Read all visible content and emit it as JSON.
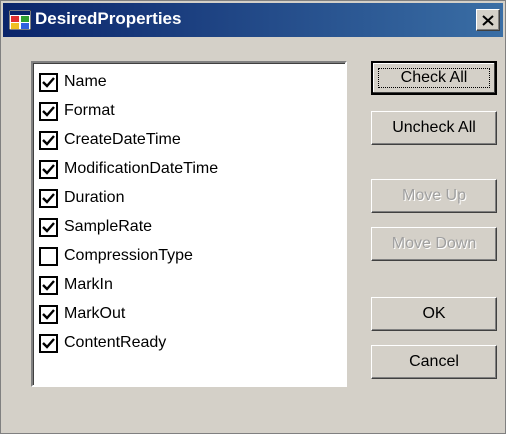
{
  "window": {
    "title": "DesiredProperties",
    "close_label": "×"
  },
  "properties": [
    {
      "label": "Name",
      "checked": true
    },
    {
      "label": "Format",
      "checked": true
    },
    {
      "label": "CreateDateTime",
      "checked": true
    },
    {
      "label": "ModificationDateTime",
      "checked": true
    },
    {
      "label": "Duration",
      "checked": true
    },
    {
      "label": "SampleRate",
      "checked": true
    },
    {
      "label": "CompressionType",
      "checked": false
    },
    {
      "label": "MarkIn",
      "checked": true
    },
    {
      "label": "MarkOut",
      "checked": true
    },
    {
      "label": "ContentReady",
      "checked": true
    }
  ],
  "buttons": {
    "check_all": "Check All",
    "uncheck_all": "Uncheck All",
    "move_up": "Move Up",
    "move_down": "Move Down",
    "ok": "OK",
    "cancel": "Cancel"
  },
  "colors": {
    "titlebar_start": "#0a246a",
    "titlebar_end": "#3a6ea5",
    "face": "#d4d0c8",
    "disabled_text": "#a0a0a0"
  }
}
